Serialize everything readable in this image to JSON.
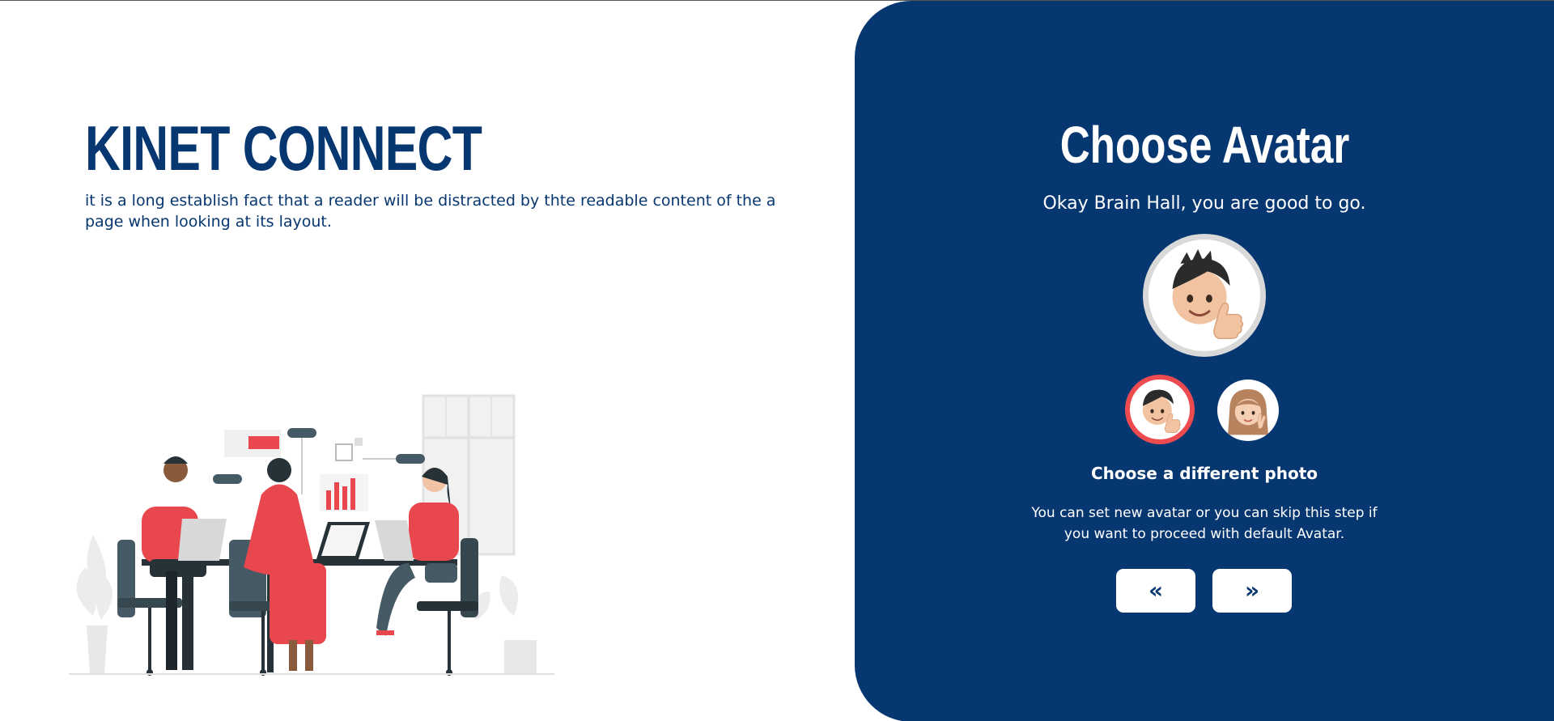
{
  "brand": {
    "title": "KINET CONNECT",
    "description": "it is a long establish fact that a reader will be distracted by thte readable content of the a page when looking at its layout."
  },
  "panel": {
    "title": "Choose Avatar",
    "greeting": "Okay Brain Hall, you are good to go.",
    "choose_label": "Choose a different photo",
    "help_text": "You can set new avatar or you can skip this step if you want to proceed with default Avatar.",
    "prev_label": "«",
    "next_label": "»"
  },
  "avatars": {
    "main": "male-avatar-thumbs-up",
    "options": [
      "male-avatar-thumbs-up",
      "female-avatar-peace-sign"
    ],
    "selected_index": 0
  },
  "colors": {
    "brand_blue": "#073770",
    "accent_red": "#ee4b50",
    "white": "#ffffff"
  },
  "icons": {
    "illustration": "team-meeting-illustration"
  }
}
